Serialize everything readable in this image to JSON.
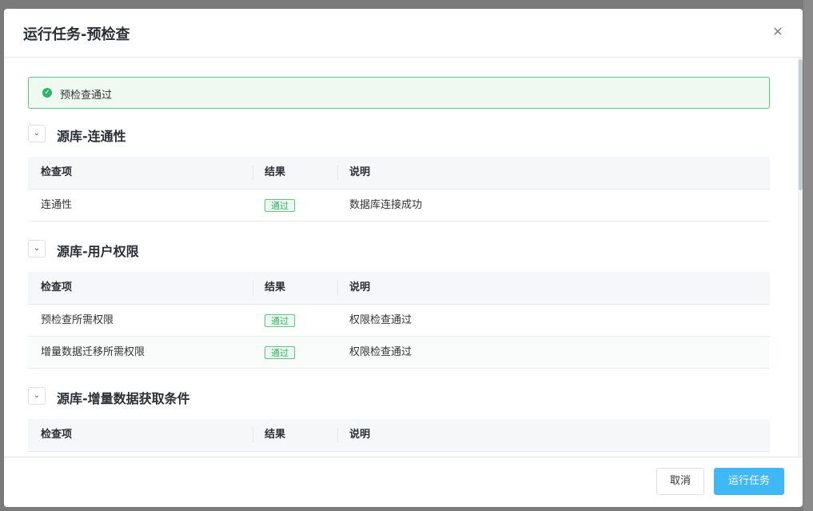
{
  "modal": {
    "title": "运行任务-预检查",
    "close_icon": "close-icon",
    "alert": {
      "icon": "check-circle-icon",
      "text": "预检查通过"
    },
    "table_headers": {
      "item": "检查项",
      "result": "结果",
      "desc": "说明"
    },
    "sections": [
      {
        "title": "源库-连通性",
        "rows": [
          {
            "item": "连通性",
            "result": "通过",
            "desc": "数据库连接成功"
          }
        ]
      },
      {
        "title": "源库-用户权限",
        "rows": [
          {
            "item": "预检查所需权限",
            "result": "通过",
            "desc": "权限检查通过"
          },
          {
            "item": "增量数据迁移所需权限",
            "result": "通过",
            "desc": "权限检查通过"
          }
        ]
      },
      {
        "title": "源库-增量数据获取条件",
        "rows": []
      }
    ],
    "footer": {
      "cancel_label": "取消",
      "run_label": "运行任务"
    }
  },
  "colors": {
    "accent": "#40b8f5",
    "success": "#2fb464"
  }
}
